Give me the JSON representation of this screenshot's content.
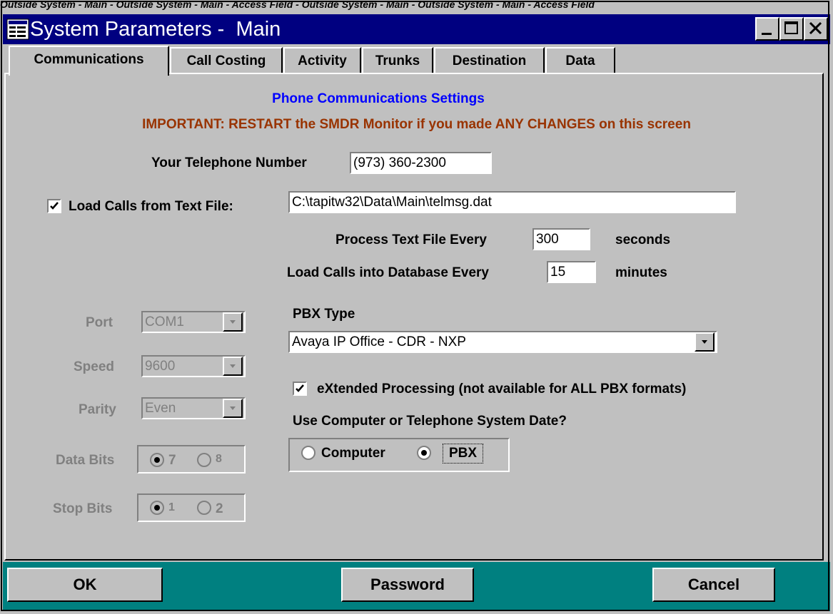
{
  "top_strip_text": "Outside System - Main - Outside System - Main - Access Field - Outside System - Main - Outside System - Main - Access Field",
  "window": {
    "title": "System Parameters -  Main"
  },
  "tabs": [
    {
      "label": "Communications",
      "active": true
    },
    {
      "label": "Call Costing",
      "active": false
    },
    {
      "label": "Activity",
      "active": false
    },
    {
      "label": "Trunks",
      "active": false
    },
    {
      "label": "Destination",
      "active": false
    },
    {
      "label": "Data",
      "active": false
    }
  ],
  "header": {
    "title": "Phone Communications Settings",
    "warning": "IMPORTANT:  RESTART the SMDR Monitor if you made ANY CHANGES on this screen"
  },
  "phone": {
    "label": "Your Telephone Number",
    "value": "(973) 360-2300"
  },
  "load_text": {
    "label": "Load Calls from Text File:",
    "checked": true,
    "value": "C:\\tapitw32\\Data\\Main\\telmsg.dat"
  },
  "process": {
    "label": "Process Text File Every",
    "value": "300",
    "unit": "seconds"
  },
  "load_db": {
    "label": "Load Calls into Database Every",
    "value": "15",
    "unit": "minutes"
  },
  "serial": {
    "port": {
      "label": "Port",
      "value": "COM1"
    },
    "speed": {
      "label": "Speed",
      "value": "9600"
    },
    "parity": {
      "label": "Parity",
      "value": "Even"
    },
    "data_bits": {
      "label": "Data Bits",
      "options": [
        "7",
        "8"
      ],
      "selected": "7"
    },
    "stop_bits": {
      "label": "Stop Bits",
      "options": [
        "1",
        "2"
      ],
      "selected": "1"
    }
  },
  "pbx": {
    "label": "PBX Type",
    "value": "Avaya IP Office - CDR - NXP"
  },
  "extended": {
    "label": "eXtended Processing  (not available for ALL PBX formats)",
    "checked": true
  },
  "date_source": {
    "label": "Use Computer or Telephone System Date?",
    "options": [
      "Computer",
      "PBX"
    ],
    "selected": "PBX"
  },
  "buttons": {
    "ok": "OK",
    "password": "Password",
    "cancel": "Cancel"
  },
  "colors": {
    "titlebar": "#000080",
    "bottombar": "#008080",
    "header_title": "#0000ff",
    "warning": "#993300",
    "face": "#c0c0c0"
  }
}
